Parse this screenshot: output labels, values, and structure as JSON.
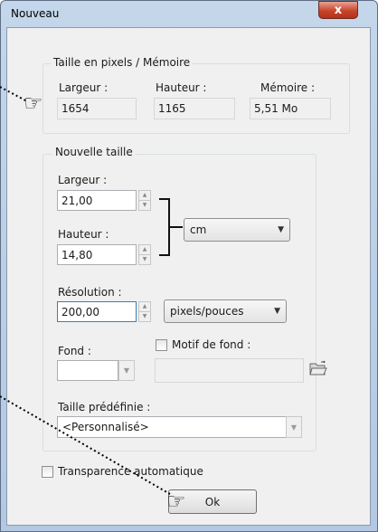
{
  "window": {
    "title": "Nouveau",
    "close_glyph": "x"
  },
  "memory_group": {
    "legend": "Taille en pixels / Mémoire",
    "width_label": "Largeur :",
    "width_value": "1654",
    "height_label": "Hauteur :",
    "height_value": "1165",
    "memory_label": "Mémoire :",
    "memory_value": "5,51 Mo"
  },
  "new_size_group": {
    "legend": "Nouvelle taille",
    "width_label": "Largeur :",
    "width_value": "21,00",
    "height_label": "Hauteur :",
    "height_value": "14,80",
    "unit_value": "cm",
    "resolution_label": "Résolution :",
    "resolution_value": "200,00",
    "resolution_unit_value": "pixels/pouces",
    "background_label": "Fond :",
    "pattern_label": "Motif de fond :",
    "pattern_checked": false,
    "preset_label": "Taille prédéfinie :",
    "preset_value": "<Personnalisé>"
  },
  "transparency_label": "Transparence automatique",
  "transparency_checked": false,
  "ok_label": "Ok",
  "icons": {
    "folder": "folder-open-icon",
    "spin_up": "▲",
    "spin_down": "▼",
    "dropdown": "▼",
    "pointer": "☞"
  }
}
